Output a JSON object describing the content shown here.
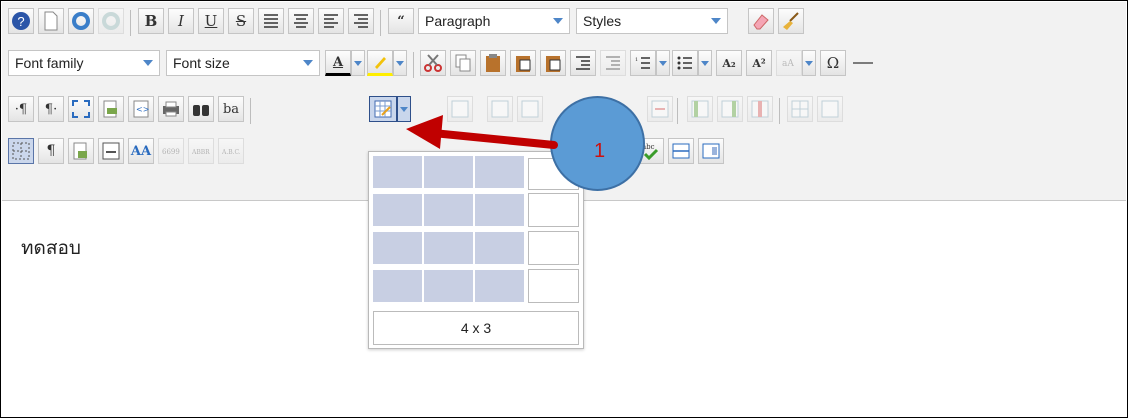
{
  "toolbar": {
    "format_select": "Paragraph",
    "styles_select": "Styles",
    "font_family_select": "Font family",
    "font_size_select": "Font size",
    "row1_buttons": [
      "help-icon",
      "new-document-icon",
      "undo-icon",
      "redo-icon",
      "bold-icon",
      "italic-icon",
      "underline-icon",
      "strikethrough-icon",
      "align-justify-icon",
      "align-center-icon",
      "align-left-icon",
      "align-right-icon",
      "blockquote-icon",
      "eraser-icon",
      "broom-icon"
    ],
    "bold_glyph": "B",
    "italic_glyph": "I",
    "underline_glyph": "U",
    "strike_glyph": "S",
    "quote_glyph": "“",
    "text_color_glyph": "A",
    "subscript_glyph": "A₂",
    "superscript_glyph": "A²",
    "omega_glyph": "Ω",
    "para_ltr_glyph": "·¶",
    "para_rtl_glyph": "¶·",
    "ba_glyph": "ba",
    "pilcrow_glyph": "¶",
    "aa_glyph": "AA"
  },
  "table_picker": {
    "rows": 4,
    "cols": 3,
    "label": "4 x 3"
  },
  "editor": {
    "content_text": "ทดสอบ"
  },
  "annotation": {
    "number": "1",
    "color": "#5b9bd5",
    "arrow_color": "#c00000"
  }
}
